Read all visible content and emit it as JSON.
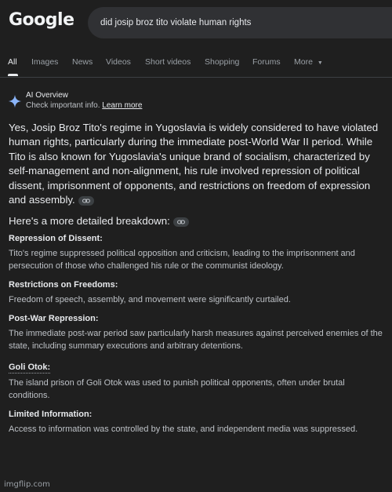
{
  "header": {
    "logo": "Google",
    "search_value": "did josip broz tito violate human rights"
  },
  "tabs": [
    {
      "label": "All",
      "active": true
    },
    {
      "label": "Images"
    },
    {
      "label": "News"
    },
    {
      "label": "Videos"
    },
    {
      "label": "Short videos"
    },
    {
      "label": "Shopping"
    },
    {
      "label": "Forums"
    },
    {
      "label": "More"
    }
  ],
  "ai_overview": {
    "title": "AI Overview",
    "subtitle": "Check important info.",
    "learn_more": "Learn more",
    "intro": "Yes, Josip Broz Tito's regime in Yugoslavia is widely considered to have violated human rights, particularly during the immediate post-World War II period. While Tito is also known for Yugoslavia's unique brand of socialism, characterized by self-management and non-alignment, his rule involved repression of political dissent, imprisonment of opponents, and restrictions on freedom of expression and assembly.",
    "breakdown": "Here's a more detailed breakdown:",
    "sections": [
      {
        "title": "Repression of Dissent:",
        "body": "Tito's regime suppressed political opposition and criticism, leading to the imprisonment and persecution of those who challenged his rule or the communist ideology."
      },
      {
        "title": "Restrictions on Freedoms:",
        "body": "Freedom of speech, assembly, and movement were significantly curtailed."
      },
      {
        "title": "Post-War Repression:",
        "body": "The immediate post-war period saw particularly harsh measures against perceived enemies of the state, including summary executions and arbitrary detentions."
      },
      {
        "title": "Goli Otok:",
        "body": "The island prison of Goli Otok was used to punish political opponents, often under brutal conditions."
      },
      {
        "title": "Limited Information:",
        "body": "Access to information was controlled by the state, and independent media was suppressed."
      }
    ]
  },
  "watermark": "imgflip.com",
  "colors": {
    "background": "#1f1f1f",
    "search_box": "#303134",
    "text": "#e8eaed",
    "muted": "#bdc1c6",
    "sparkle": "#8ab4f8"
  }
}
